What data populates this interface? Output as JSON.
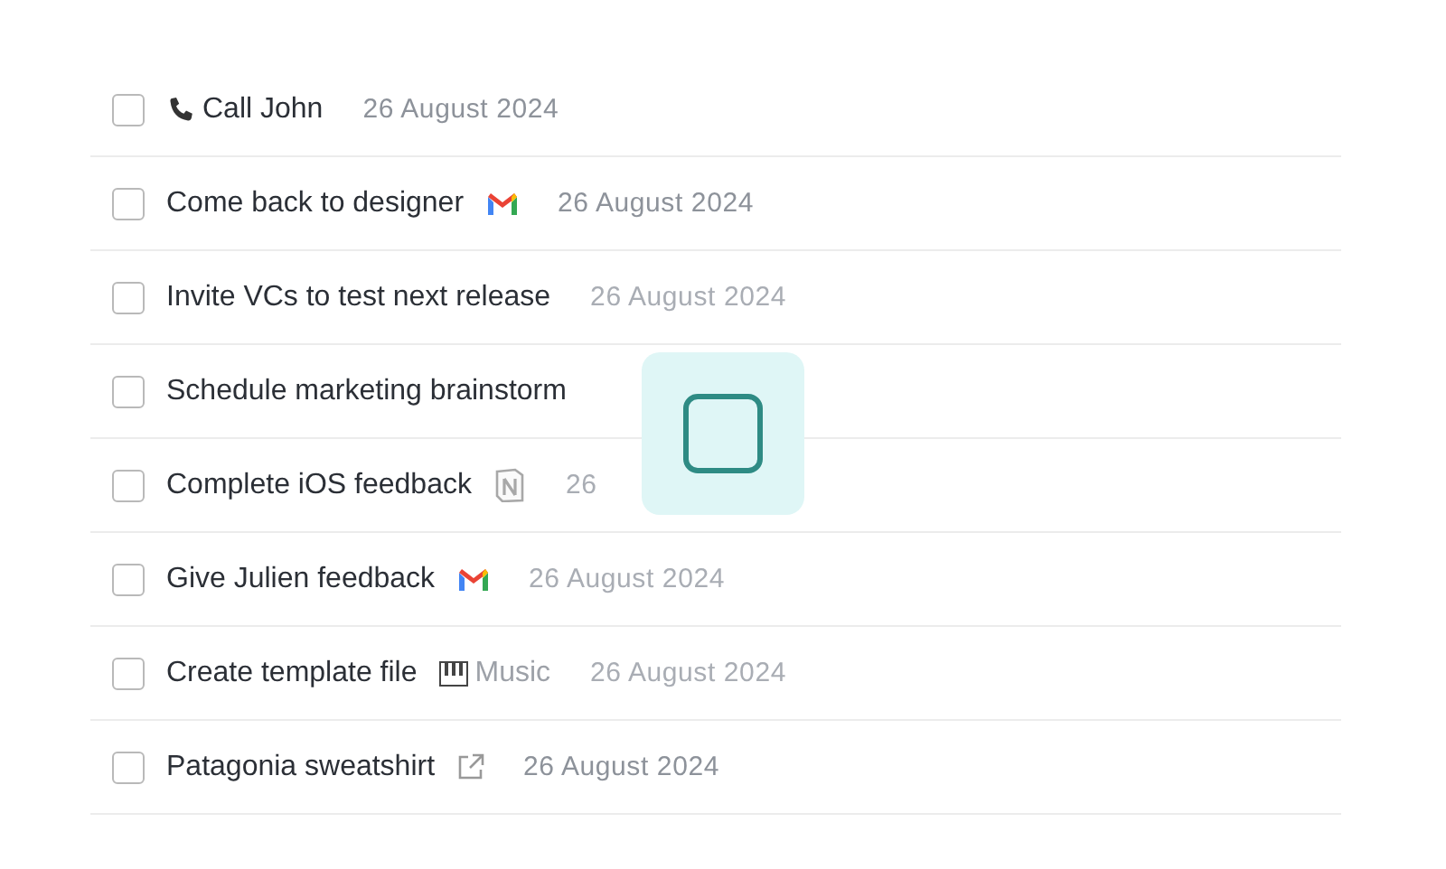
{
  "tasks": [
    {
      "kind": "call",
      "title": "Call John",
      "date": "26 August 2024",
      "date_faded": false,
      "checked": false
    },
    {
      "kind": "email",
      "title": "Come back to designer",
      "date": "26 August 2024",
      "date_faded": false,
      "checked": false
    },
    {
      "kind": "plain",
      "title": "Invite VCs to test next release",
      "date": "26 August 2024",
      "date_faded": true,
      "checked": false
    },
    {
      "kind": "plain",
      "title": "Schedule marketing brainstorm",
      "checked": false
    },
    {
      "kind": "doc",
      "title": "Complete iOS feedback",
      "date": "26",
      "date_faded": true,
      "checked": false
    },
    {
      "kind": "email",
      "title": "Give Julien feedback",
      "date": "26 August 2024",
      "date_faded": true,
      "checked": false
    },
    {
      "kind": "music",
      "title": "Create template file",
      "tag": "Music",
      "date": "26 August 2024",
      "date_faded": true,
      "checked": false
    },
    {
      "kind": "link",
      "title": "Patagonia sweatshirt",
      "date": "26 August 2024",
      "date_faded": false,
      "checked": false
    }
  ],
  "drag_tile": {
    "checked": false
  }
}
